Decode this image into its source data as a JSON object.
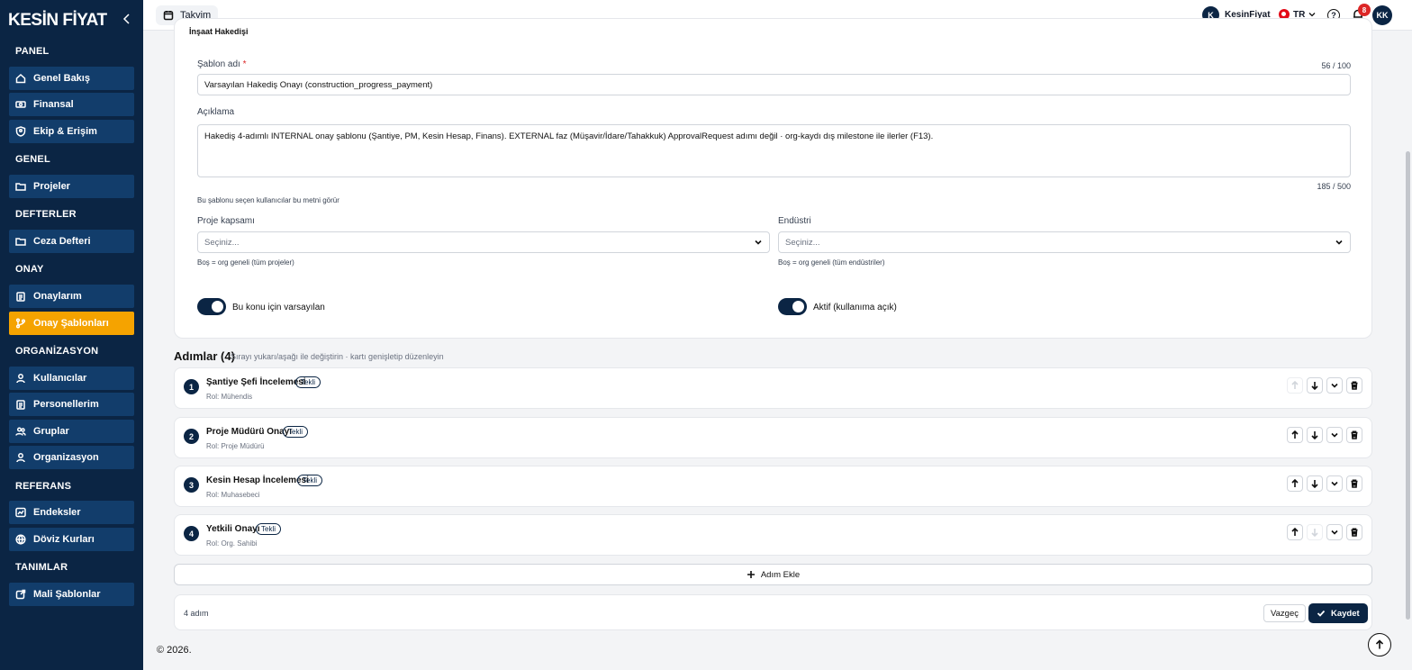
{
  "brand": {
    "logo": "KESİN FİYAT"
  },
  "sidebar": {
    "sections": [
      {
        "title": "PANEL",
        "items": [
          {
            "label": "Genel Bakış",
            "icon": "home-icon"
          },
          {
            "label": "Finansal",
            "icon": "cash-icon"
          },
          {
            "label": "Ekip & Erişim",
            "icon": "shield-user-icon"
          }
        ]
      },
      {
        "title": "GENEL",
        "items": [
          {
            "label": "Projeler",
            "icon": "folder-icon"
          }
        ]
      },
      {
        "title": "DEFTERLER",
        "items": [
          {
            "label": "Ceza Defteri",
            "icon": "folder-icon"
          }
        ]
      },
      {
        "title": "ONAY",
        "items": [
          {
            "label": "Onaylarım",
            "icon": "clipboard-icon"
          },
          {
            "label": "Onay Şablonları",
            "icon": "branch-icon",
            "active": true
          }
        ]
      },
      {
        "title": "ORGANİZASYON",
        "items": [
          {
            "label": "Kullanıcılar",
            "icon": "user-icon"
          },
          {
            "label": "Personellerim",
            "icon": "clipboard-icon"
          },
          {
            "label": "Gruplar",
            "icon": "users-icon"
          },
          {
            "label": "Organizasyon",
            "icon": "user-icon"
          }
        ]
      },
      {
        "title": "REFERANS",
        "items": [
          {
            "label": "Endeksler",
            "icon": "chart-icon"
          },
          {
            "label": "Döviz Kurları",
            "icon": "globe-icon"
          }
        ]
      },
      {
        "title": "TANIMLAR",
        "items": [
          {
            "label": "Mali Şablonlar",
            "icon": "external-icon"
          }
        ]
      }
    ]
  },
  "topbar": {
    "calendar_label": "Takvim",
    "org_initial": "K",
    "org_name": "KesinFiyat",
    "lang": "TR",
    "help_glyph": "?",
    "notifications": "8",
    "user_initials": "KK"
  },
  "form": {
    "section_title": "İnşaat Hakedişi",
    "name_label": "Şablon adı",
    "name_required": "*",
    "name_counter": "56 / 100",
    "name_value": "Varsayılan Hakediş Onayı (construction_progress_payment)",
    "desc_label": "Açıklama",
    "desc_value": "Hakediş 4-adımlı INTERNAL onay şablonu (Şantiye, PM, Kesin Hesap, Finans). EXTERNAL faz (Müşavir/İdare/Tahakkuk) ApprovalRequest adımı değil · org-kaydı dış milestone ile ilerler (F13).",
    "desc_counter": "185 / 500",
    "desc_help": "Bu şablonu seçen kullanıcılar bu metni görür",
    "scope_label": "Proje kapsamı",
    "scope_placeholder": "Seçiniz...",
    "scope_help": "Boş = org geneli (tüm projeler)",
    "industry_label": "Endüstri",
    "industry_placeholder": "Seçiniz...",
    "industry_help": "Boş = org geneli (tüm endüstriler)",
    "default_toggle_label": "Bu konu için varsayılan",
    "active_toggle_label": "Aktif (kullanıma açık)"
  },
  "steps": {
    "title": "Adımlar (4)",
    "hint": "Sırayı yukarı/aşağı ile değiştirin · kartı genişletip düzenleyin",
    "items": [
      {
        "num": "1",
        "name": "Şantiye Şefi İncelemesi",
        "tag": "Tekli",
        "role": "Rol: Mühendis"
      },
      {
        "num": "2",
        "name": "Proje Müdürü Onayı",
        "tag": "Tekli",
        "role": "Rol: Proje Müdürü"
      },
      {
        "num": "3",
        "name": "Kesin Hesap İncelemesi",
        "tag": "Tekli",
        "role": "Rol: Muhasebeci"
      },
      {
        "num": "4",
        "name": "Yetkili Onayı",
        "tag": "Tekli",
        "role": "Rol: Org. Sahibi"
      }
    ],
    "add_label": "Adım Ekle"
  },
  "footer": {
    "count": "4 adım",
    "cancel": "Vazgeç",
    "save": "Kaydet",
    "copyright": "© 2026."
  },
  "colors": {
    "sidebar_bg": "#0b2544",
    "nav_item_bg": "#123d6b",
    "active_accent": "#f5a300",
    "primary": "#0b2544",
    "badge": "#dc2626"
  }
}
